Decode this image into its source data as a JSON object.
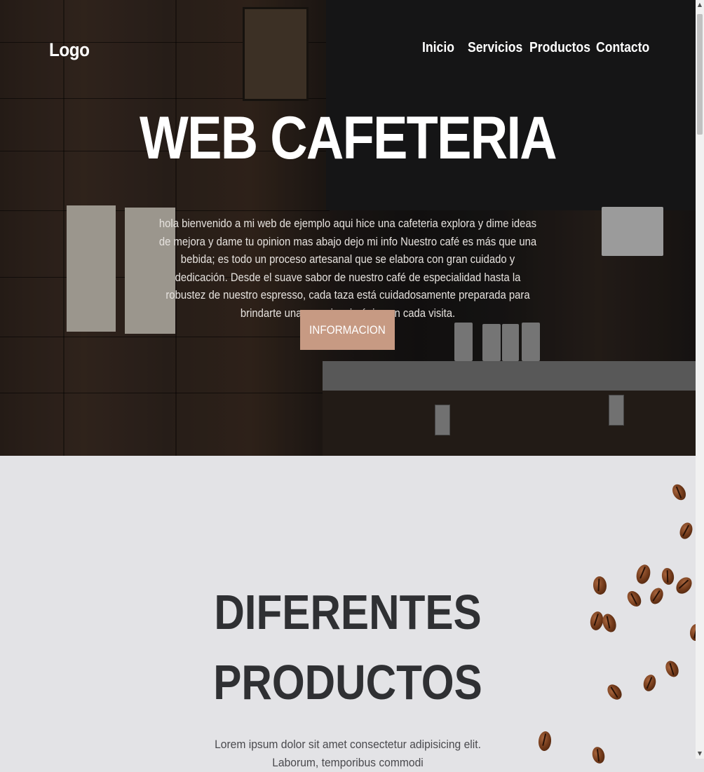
{
  "header": {
    "logo": "Logo",
    "nav": [
      "Inicio",
      "Servicios",
      "Productos",
      "Contacto"
    ]
  },
  "hero": {
    "title": "WEB CAFETERIA",
    "text": "hola bienvenido a mi web de ejemplo aqui hice una cafeteria explora y dime ideas de mejora y dame tu opinion mas abajo dejo mi info Nuestro café es más que una bebida; es todo un proceso artesanal que se elabora con gran cuidado y dedicación. Desde el suave sabor de nuestro café de especialidad hasta la robustez de nuestro espresso, cada taza está cuidadosamente preparada para brindarte una experiencia única en cada visita.",
    "button": "INFORMACION"
  },
  "products": {
    "title_line1": "DIFERENTES",
    "title_line2": "PRODUCTOS",
    "text": "Lorem ipsum dolor sit amet consectetur adipisicing elit. Laborum, temporibus commodi"
  },
  "colors": {
    "accent": "#c79a83",
    "section_bg": "#e3e3e6",
    "heading": "#2f3033"
  },
  "icons": {
    "scroll_up": "scroll-up-arrow-icon",
    "scroll_down": "scroll-down-arrow-icon"
  }
}
